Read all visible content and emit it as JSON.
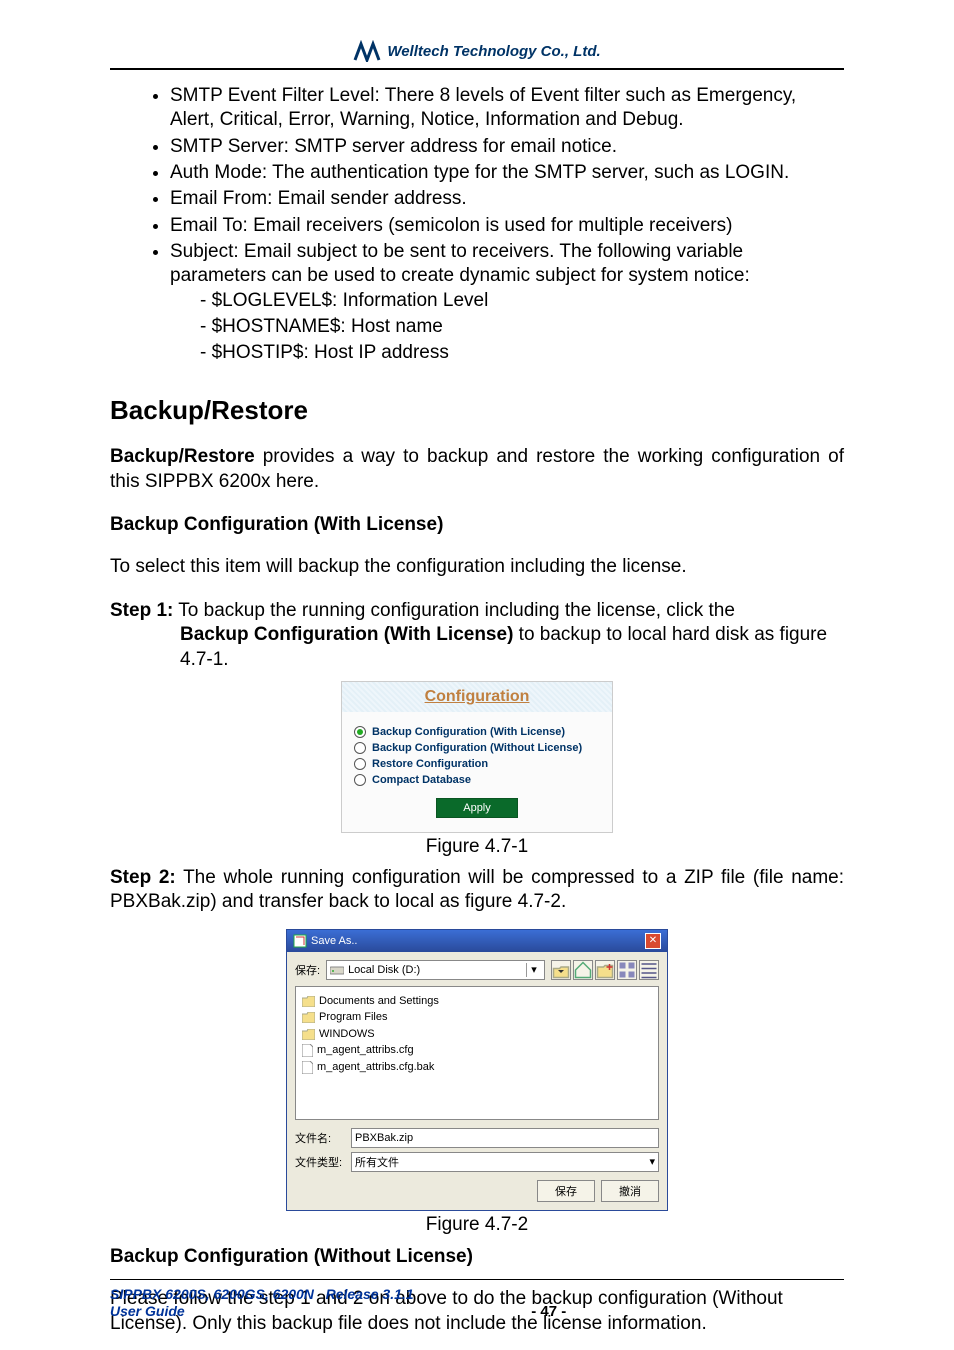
{
  "brand": {
    "company": "Welltech Technology Co., Ltd."
  },
  "bullets": {
    "b1": "SMTP Event Filter Level: There 8 levels of Event filter such as Emergency, Alert, Critical, Error, Warning, Notice, Information and Debug.",
    "b2": "SMTP Server: SMTP server address for email notice.",
    "b3": "Auth Mode: The authentication type for the SMTP server, such as LOGIN.",
    "b4": "Email From: Email sender address.",
    "b5": "Email To: Email receivers (semicolon is used for multiple receivers)",
    "b6": "Subject: Email subject to be sent to receivers. The following variable parameters can be used to create dynamic subject for system notice:",
    "d1": "$LOGLEVEL$: Information Level",
    "d2": "$HOSTNAME$: Host name",
    "d3": "$HOSTIP$: Host IP address"
  },
  "section": {
    "title": "Backup/Restore",
    "intro_strong": "Backup/Restore",
    "intro_rest": " provides a way to backup and restore the working configuration of this SIPPBX 6200x here."
  },
  "sub1": {
    "title": "Backup Configuration (With License)",
    "lead": "To select this item will backup the configuration including the license.",
    "step1_label": "Step 1:",
    "step1_text_a": " To backup the running configuration including the license, click the ",
    "step1_text_b": "Backup Configuration (With License)",
    "step1_text_c": " to backup to local hard disk as figure 4.7-1.",
    "fig1_caption": "Figure 4.7-1",
    "step2_label": "Step 2:",
    "step2_text": " The whole running configuration will be compressed to a ZIP file (file name: PBXBak.zip) and transfer back to local as figure 4.7-2.",
    "fig2_caption": "Figure 4.7-2"
  },
  "conf_panel": {
    "header": "Configuration",
    "opt1": "Backup Configuration (With License)",
    "opt2": "Backup Configuration (Without License)",
    "opt3": "Restore Configuration",
    "opt4": "Compact Database",
    "apply": "Apply"
  },
  "saveas": {
    "title": "Save As..",
    "loc_label": "保存:",
    "drive": "Local Disk (D:)",
    "files": {
      "f1": "Documents and Settings",
      "f2": "Program Files",
      "f3": "WINDOWS",
      "f4": "m_agent_attribs.cfg",
      "f5": "m_agent_attribs.cfg.bak"
    },
    "name_label": "文件名:",
    "name_value": "PBXBak.zip",
    "type_label": "文件类型:",
    "type_value": "所有文件",
    "save_btn": "保存",
    "cancel_btn": "撤消"
  },
  "sub2": {
    "title": "Backup Configuration (Without License)",
    "text": "Please follow the step 1 and 2 on above to do the backup configuration (Without License). Only this backup file does not include the license information."
  },
  "footer": {
    "left_line1": "SIPPBX 6200S, 6200GS, 6200N",
    "left_line1b": "Release 3.1.1",
    "left_line2": "User Guide",
    "page": "- 47 -"
  }
}
